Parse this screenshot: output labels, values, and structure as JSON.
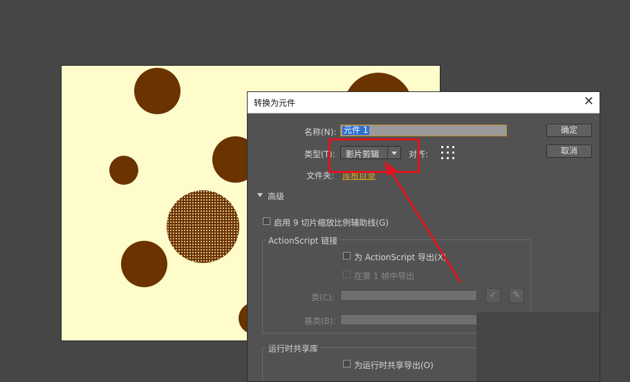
{
  "dialog": {
    "title": "转换为元件",
    "name_label": "名称(N):",
    "name_value": "元件 1",
    "type_label": "类型(T):",
    "type_value": "影片剪辑",
    "align_label": "对齐:",
    "folder_label": "文件夹:",
    "folder_link": "库根目录",
    "ok_label": "确定",
    "cancel_label": "取消",
    "advanced_label": "高级",
    "enable_9slice": "启用 9 切片缩放比例辅助线(G)",
    "actionscript_legend": "ActionScript 链接",
    "export_for_as": "为 ActionScript 导出(X)",
    "export_frame1": "在第 1 帧中导出",
    "class_label": "类(C):",
    "base_class_label": "基类(B):",
    "runtime_legend": "运行时共享库",
    "export_runtime": "为运行时共享导出(O)"
  },
  "colors": {
    "stage_bg": "#fffccc",
    "dot_color": "#6b3300",
    "highlight": "#e0141e",
    "link_color": "#e0a21c"
  }
}
